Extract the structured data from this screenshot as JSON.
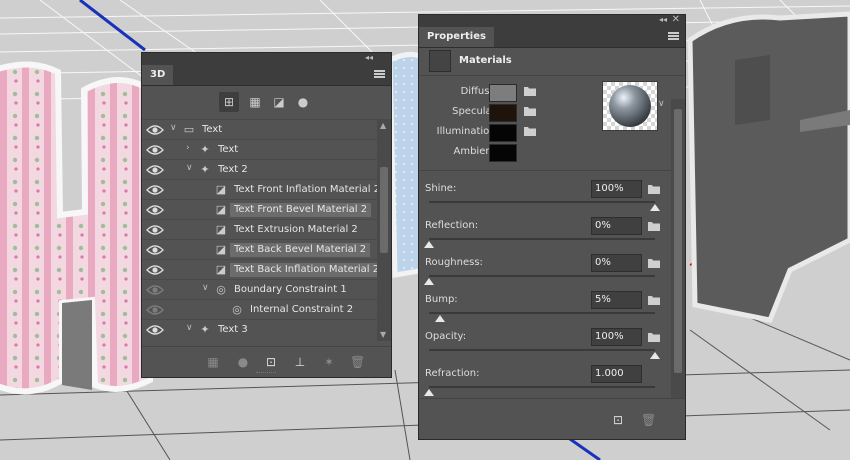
{
  "panel_3d": {
    "title": "3D",
    "filter_icons": [
      "whole-scene-icon",
      "meshes-icon",
      "materials-icon",
      "lights-icon"
    ],
    "layers": [
      {
        "label": "Text",
        "indent": 0,
        "arrow": "expanded",
        "icon": "folder-icon",
        "eye": true,
        "highlight": false
      },
      {
        "label": "Text",
        "indent": 1,
        "arrow": "collapsed",
        "icon": "mesh-icon",
        "eye": true,
        "highlight": false
      },
      {
        "label": "Text 2",
        "indent": 1,
        "arrow": "expanded",
        "icon": "mesh-icon",
        "eye": true,
        "highlight": false
      },
      {
        "label": "Text Front Inflation Material 2",
        "indent": 2,
        "arrow": "",
        "icon": "material-icon",
        "eye": true,
        "highlight": false
      },
      {
        "label": "Text Front Bevel Material 2",
        "indent": 2,
        "arrow": "",
        "icon": "material-icon",
        "eye": true,
        "highlight": true
      },
      {
        "label": "Text Extrusion Material 2",
        "indent": 2,
        "arrow": "",
        "icon": "material-icon",
        "eye": true,
        "highlight": false
      },
      {
        "label": "Text Back Bevel Material 2",
        "indent": 2,
        "arrow": "",
        "icon": "material-icon",
        "eye": true,
        "highlight": true
      },
      {
        "label": "Text Back Inflation Material 2",
        "indent": 2,
        "arrow": "",
        "icon": "material-icon",
        "eye": true,
        "highlight": true
      },
      {
        "label": "Boundary Constraint 1",
        "indent": 2,
        "arrow": "expanded",
        "icon": "constraint-icon",
        "eye": false,
        "highlight": false
      },
      {
        "label": "Internal Constraint 2",
        "indent": 3,
        "arrow": "",
        "icon": "constraint-icon",
        "eye": false,
        "highlight": false
      },
      {
        "label": "Text 3",
        "indent": 1,
        "arrow": "expanded",
        "icon": "mesh-icon",
        "eye": true,
        "highlight": false
      }
    ],
    "bottom_icons": [
      "add-mesh-icon",
      "add-light-icon",
      "render-icon",
      "drop-to-plane-icon",
      "new-light-icon",
      "delete-icon"
    ]
  },
  "properties": {
    "title": "Properties",
    "section": "Materials",
    "swatches": [
      {
        "label": "Diffuse:",
        "color": "#7d7d7d"
      },
      {
        "label": "Specular:",
        "color": "#1f140c"
      },
      {
        "label": "Illumination:",
        "color": "#050505"
      },
      {
        "label": "Ambient:",
        "color": "#050505"
      }
    ],
    "params": [
      {
        "label": "Shine:",
        "value": "100%",
        "level": 1.0
      },
      {
        "label": "Reflection:",
        "value": "0%",
        "level": 0.0
      },
      {
        "label": "Roughness:",
        "value": "0%",
        "level": 0.0
      },
      {
        "label": "Bump:",
        "value": "5%",
        "level": 0.05
      },
      {
        "label": "Opacity:",
        "value": "100%",
        "level": 1.0
      },
      {
        "label": "Refraction:",
        "value": "1.000",
        "level": 0.0
      }
    ]
  }
}
